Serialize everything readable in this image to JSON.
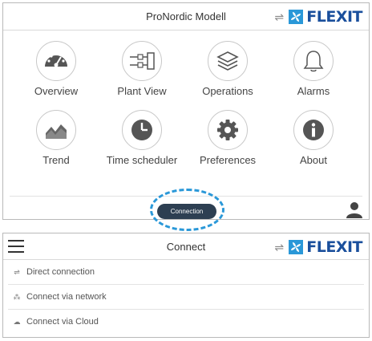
{
  "screen1": {
    "title": "ProNordic Modell",
    "brand": {
      "arrows": "⇌",
      "name": "FLEXIT"
    },
    "tiles": [
      {
        "label": "Overview"
      },
      {
        "label": "Plant View"
      },
      {
        "label": "Operations"
      },
      {
        "label": "Alarms"
      },
      {
        "label": "Trend"
      },
      {
        "label": "Time scheduler"
      },
      {
        "label": "Preferences"
      },
      {
        "label": "About"
      }
    ],
    "connection_label": "Connection"
  },
  "screen2": {
    "title": "Connect",
    "brand": {
      "arrows": "⇌",
      "name": "FLEXIT"
    },
    "items": [
      {
        "icon": "⇌",
        "label": "Direct connection"
      },
      {
        "icon": "⁂",
        "label": "Connect via network"
      },
      {
        "icon": "☁",
        "label": "Connect via Cloud"
      }
    ]
  },
  "colors": {
    "brand_blue": "#1a4f9c",
    "accent_cyan": "#2a98d8",
    "button_dark": "#2d3f52"
  }
}
